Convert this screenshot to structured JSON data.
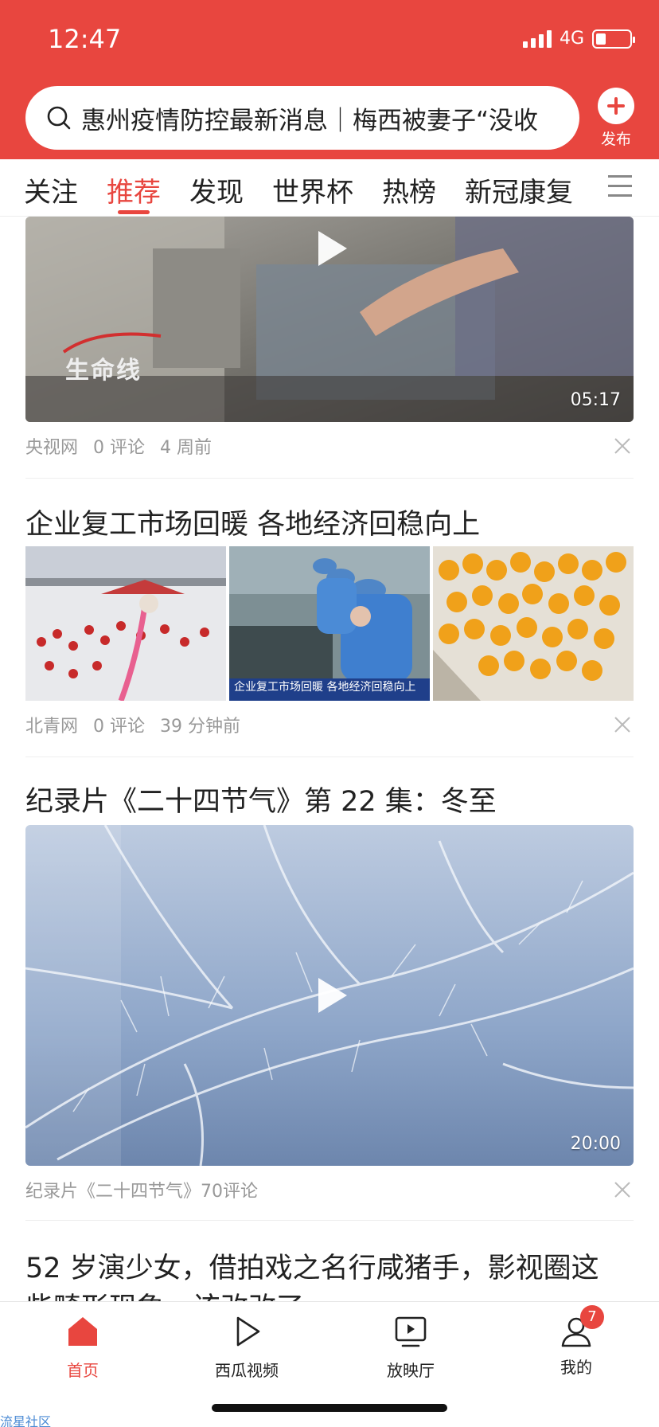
{
  "status": {
    "time": "12:47",
    "network": "4G"
  },
  "search": {
    "text": "惠州疫情防控最新消息｜梅西被妻子“没收"
  },
  "publish": {
    "label": "发布"
  },
  "tabs": [
    {
      "label": "关注"
    },
    {
      "label": "推荐"
    },
    {
      "label": "发现"
    },
    {
      "label": "世界杯"
    },
    {
      "label": "热榜"
    },
    {
      "label": "新冠康复"
    }
  ],
  "feed": {
    "video1": {
      "logo": "生命线",
      "duration": "05:17",
      "source": "央视网",
      "comments": "0 评论",
      "time": "4 周前"
    },
    "article": {
      "title": "企业复工市场回暖 各地经济回稳向上",
      "image_caption": "企业复工市场回暖 各地经济回稳向上",
      "source": "北青网",
      "comments": "0 评论",
      "time": "39 分钟前"
    },
    "video2": {
      "title": "纪录片《二十四节气》第 22 集：冬至",
      "duration": "20:00",
      "meta": "纪录片《二十四节气》70评论"
    },
    "next": {
      "title_line1": "52 岁演少女，借拍戏之名行咸猪手，影视圈这",
      "title_line2": "些畸形现象，该改改了"
    }
  },
  "bottom_nav": [
    {
      "label": "首页"
    },
    {
      "label": "西瓜视频"
    },
    {
      "label": "放映厅"
    },
    {
      "label": "我的",
      "badge": "7"
    }
  ],
  "corner_text": "流星社区",
  "colors": {
    "accent": "#e8463f",
    "meta": "#999999"
  }
}
